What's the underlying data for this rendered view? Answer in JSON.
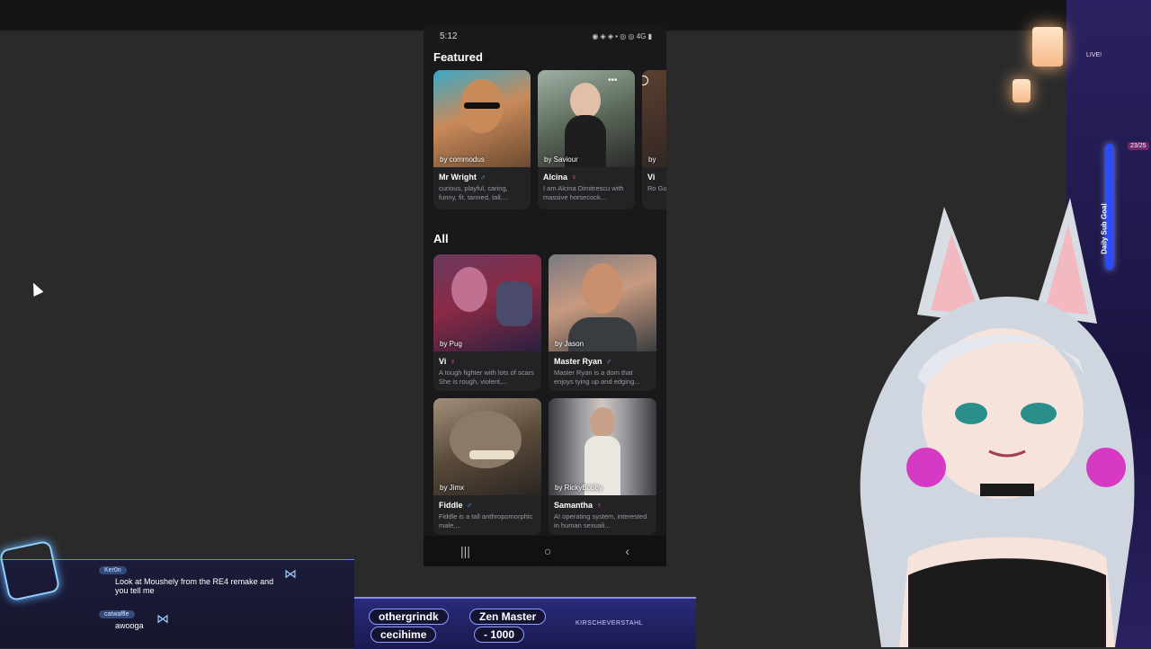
{
  "phone": {
    "status_time": "5:12",
    "status_icons": "◉ ◈ ◈ • ◎ ◎ 4G ▮",
    "featured_title": "Featured",
    "featured": [
      {
        "name": "Mr Wright",
        "gender": "♂",
        "by": "by commodus",
        "desc": "curious, playful, caring, funny, fit, tanned, tall,..."
      },
      {
        "name": "Alcina",
        "gender": "♀",
        "by": "by Saviour",
        "desc": "I am Alcina Dimitrescu with massive horsecock..."
      },
      {
        "name": "Vi",
        "gender": "",
        "by": "by",
        "desc": "Ro Gu"
      }
    ],
    "all_title": "All",
    "all": [
      {
        "name": "Vi",
        "gender": "♀",
        "by": "by Pug",
        "desc": "A tough fighter with lots of scars She is rough, violent,..."
      },
      {
        "name": "Master Ryan",
        "gender": "♂",
        "by": "by Jason",
        "desc": "Master Ryan is a dom that enjoys tying up and edging..."
      },
      {
        "name": "Fiddle",
        "gender": "♂",
        "by": "by Jimx",
        "desc": "Fiddle is a tall anthropomorphic male,..."
      },
      {
        "name": "Samantha",
        "gender": "♀",
        "by": "by RickyBobby",
        "desc": "AI operating system, interested in human sexuali..."
      }
    ],
    "nav": {
      "recents": "|||",
      "home": "○",
      "back": "‹"
    }
  },
  "chat": [
    {
      "user": "Ker0n",
      "text": "Look at Moushely from the RE4 remake and you tell me"
    },
    {
      "user": "catwaffle",
      "text": "awooga"
    }
  ],
  "banner": {
    "pill1": "othergrindk",
    "pill2": "Zen Master",
    "pill3": "cecihime",
    "pill4": "- 1000",
    "ticker": "KIRSCHEVERSTAHL"
  },
  "overlay": {
    "live": "LIVE!",
    "goal": "Daily Sub Goal",
    "count": "23/25"
  },
  "colors": {
    "male": "#5aa7ff",
    "female": "#ff5aa8",
    "accent": "#8da0ff"
  }
}
